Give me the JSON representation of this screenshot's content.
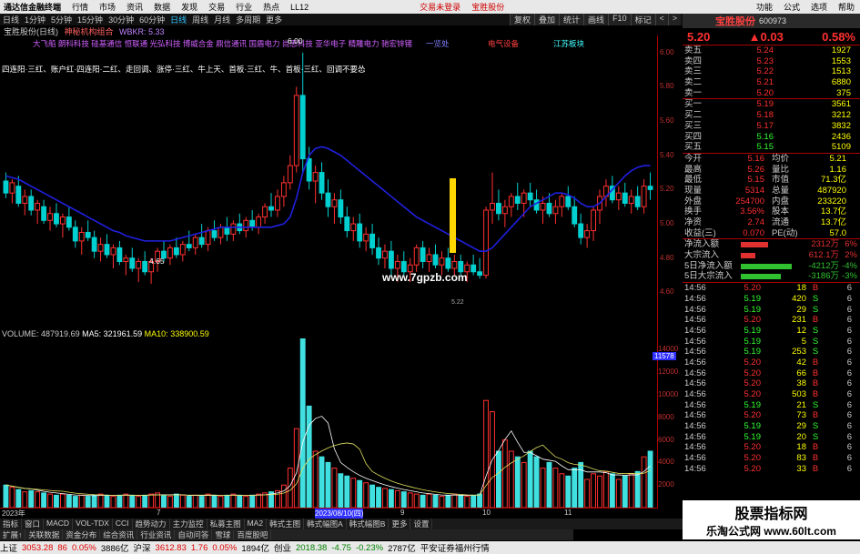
{
  "menubar": {
    "app_title": "通达信金融终端",
    "items": [
      "行情",
      "市场",
      "资讯",
      "数据",
      "发现",
      "交易",
      "行业",
      "热点",
      "LL12"
    ],
    "trade_status": "交易未登录",
    "stock_link": "宝胜股份",
    "right_items": [
      "功能",
      "公式",
      "选项",
      "帮助"
    ]
  },
  "periodbar": {
    "items": [
      "日线",
      "1分钟",
      "5分钟",
      "15分钟",
      "30分钟",
      "60分钟",
      "日线",
      "周线",
      "月线",
      "多周期",
      "更多"
    ],
    "active_index": 6
  },
  "quickbar": [
    "复权",
    "叠加",
    "统计",
    "画线",
    "F10",
    "标记",
    "<",
    ">"
  ],
  "titlebar": {
    "stock": "宝胜股份(日线)",
    "indicator": "神秘机构组合",
    "wbkr": "WBKR: 5.33"
  },
  "chart_labels": {
    "top_names": "大飞船  朗科科技  硅基通信  恒联通  光弘科技  博威合金  鼎信通讯  国盾电力  尚思科技  亚华电子  精雕电力  驰宏锌锗",
    "sector1": "一览处",
    "sector2": "电气设备",
    "sector3": "江苏板块",
    "pattern_text": "四连阳·三红、账户红·四连阳·二红、走回调、涨停·三红、牛上天、首板·三红、牛、首板·三红、回调不要怂",
    "low_label": "4.65",
    "high_label": "6.00",
    "watermark_site": "www.7gpzb.com",
    "bottom_tag": "5.22"
  },
  "chart_data": [
    {
      "type": "candlestick",
      "title": "",
      "ylim": [
        4.4,
        6.1
      ],
      "yticks": [
        "6.00",
        "5.80",
        "5.60",
        "5.40",
        "5.20",
        "5.00",
        "4.80",
        "4.60"
      ],
      "ohlc": [
        [
          5.25,
          5.3,
          5.15,
          5.18
        ],
        [
          5.18,
          5.26,
          5.12,
          5.24
        ],
        [
          5.22,
          5.28,
          5.1,
          5.12
        ],
        [
          5.12,
          5.2,
          5.05,
          5.16
        ],
        [
          5.16,
          5.2,
          5.05,
          5.08
        ],
        [
          5.08,
          5.14,
          5.0,
          5.12
        ],
        [
          5.1,
          5.14,
          5.0,
          5.02
        ],
        [
          5.02,
          5.1,
          4.96,
          5.06
        ],
        [
          5.06,
          5.12,
          4.98,
          5.0
        ],
        [
          5.0,
          5.06,
          4.92,
          5.04
        ],
        [
          5.04,
          5.1,
          4.96,
          4.98
        ],
        [
          4.98,
          5.02,
          4.86,
          4.9
        ],
        [
          4.9,
          4.98,
          4.82,
          4.95
        ],
        [
          4.95,
          5.02,
          4.9,
          4.92
        ],
        [
          4.92,
          4.96,
          4.8,
          4.84
        ],
        [
          4.84,
          4.92,
          4.78,
          4.88
        ],
        [
          4.88,
          4.94,
          4.8,
          4.82
        ],
        [
          4.82,
          4.88,
          4.74,
          4.86
        ],
        [
          4.86,
          4.9,
          4.76,
          4.78
        ],
        [
          4.78,
          4.82,
          4.7,
          4.8
        ],
        [
          4.8,
          4.86,
          4.72,
          4.74
        ],
        [
          4.74,
          4.8,
          4.66,
          4.78
        ],
        [
          4.78,
          4.84,
          4.7,
          4.72
        ],
        [
          4.72,
          4.8,
          4.65,
          4.78
        ],
        [
          4.78,
          4.86,
          4.72,
          4.84
        ],
        [
          4.84,
          4.9,
          4.78,
          4.8
        ],
        [
          4.8,
          4.88,
          4.76,
          4.86
        ],
        [
          4.86,
          4.92,
          4.8,
          4.82
        ],
        [
          4.82,
          4.9,
          4.78,
          4.88
        ],
        [
          4.88,
          4.96,
          4.84,
          4.86
        ],
        [
          4.86,
          4.94,
          4.82,
          4.92
        ],
        [
          4.92,
          5.0,
          4.86,
          4.88
        ],
        [
          4.88,
          4.98,
          4.84,
          4.96
        ],
        [
          4.96,
          5.02,
          4.9,
          4.92
        ],
        [
          4.92,
          5.0,
          4.88,
          4.98
        ],
        [
          4.98,
          5.04,
          4.9,
          4.94
        ],
        [
          4.94,
          5.02,
          4.9,
          5.0
        ],
        [
          5.0,
          5.06,
          4.94,
          4.96
        ],
        [
          4.96,
          5.04,
          4.92,
          5.02
        ],
        [
          5.02,
          5.08,
          4.96,
          4.98
        ],
        [
          4.98,
          5.06,
          4.94,
          5.04
        ],
        [
          5.04,
          5.12,
          5.0,
          5.1
        ],
        [
          5.1,
          5.18,
          5.04,
          5.08
        ],
        [
          5.08,
          5.2,
          5.04,
          5.16
        ],
        [
          5.16,
          5.28,
          5.1,
          5.24
        ],
        [
          5.24,
          5.4,
          5.2,
          5.34
        ],
        [
          5.34,
          5.8,
          5.3,
          5.75
        ],
        [
          5.75,
          6.0,
          5.3,
          5.38
        ],
        [
          5.38,
          5.45,
          5.2,
          5.25
        ],
        [
          5.25,
          5.34,
          5.12,
          5.3
        ],
        [
          5.3,
          5.36,
          5.14,
          5.18
        ],
        [
          5.18,
          5.26,
          5.04,
          5.1
        ],
        [
          5.1,
          5.18,
          5.0,
          5.14
        ],
        [
          5.14,
          5.2,
          5.0,
          5.04
        ],
        [
          5.04,
          5.1,
          4.92,
          4.96
        ],
        [
          4.96,
          5.04,
          4.9,
          5.0
        ],
        [
          5.0,
          5.06,
          4.86,
          4.9
        ],
        [
          4.9,
          4.98,
          4.84,
          4.94
        ],
        [
          4.94,
          5.0,
          4.82,
          4.86
        ],
        [
          4.86,
          4.92,
          4.76,
          4.8
        ],
        [
          4.8,
          4.88,
          4.74,
          4.84
        ],
        [
          4.84,
          4.9,
          4.7,
          4.74
        ],
        [
          4.74,
          4.82,
          4.66,
          4.78
        ],
        [
          4.78,
          4.84,
          4.7,
          4.72
        ],
        [
          4.72,
          4.8,
          4.66,
          4.76
        ],
        [
          4.76,
          4.88,
          4.72,
          4.86
        ],
        [
          4.86,
          4.9,
          4.74,
          4.78
        ],
        [
          4.78,
          4.86,
          4.72,
          4.82
        ],
        [
          4.82,
          4.88,
          4.74,
          4.76
        ],
        [
          4.76,
          4.84,
          4.7,
          4.8
        ],
        [
          4.8,
          4.86,
          4.72,
          4.74
        ],
        [
          4.74,
          4.82,
          4.7,
          4.78
        ],
        [
          4.78,
          4.82,
          4.7,
          4.72
        ],
        [
          4.72,
          4.78,
          4.66,
          4.76
        ],
        [
          4.76,
          4.82,
          4.7,
          4.72
        ],
        [
          4.72,
          4.8,
          4.68,
          4.7
        ],
        [
          4.7,
          5.1,
          4.68,
          5.08
        ],
        [
          5.08,
          5.3,
          5.0,
          5.12
        ],
        [
          5.12,
          5.2,
          5.02,
          5.06
        ],
        [
          5.06,
          5.14,
          4.98,
          5.1
        ],
        [
          5.1,
          5.18,
          5.04,
          5.16
        ],
        [
          5.16,
          5.24,
          5.08,
          5.12
        ],
        [
          5.12,
          5.2,
          5.04,
          5.18
        ],
        [
          5.18,
          5.24,
          5.1,
          5.14
        ],
        [
          5.14,
          5.2,
          5.06,
          5.08
        ],
        [
          5.08,
          5.16,
          5.0,
          5.12
        ],
        [
          5.12,
          5.18,
          5.04,
          5.06
        ],
        [
          5.06,
          5.14,
          5.0,
          5.1
        ],
        [
          5.1,
          5.18,
          5.04,
          5.16
        ],
        [
          5.16,
          5.22,
          5.08,
          5.1
        ],
        [
          5.1,
          5.16,
          4.98,
          5.0
        ],
        [
          5.0,
          5.06,
          4.88,
          4.92
        ],
        [
          4.92,
          5.0,
          4.86,
          4.96
        ],
        [
          4.96,
          5.1,
          4.9,
          5.08
        ],
        [
          5.08,
          5.2,
          5.0,
          5.16
        ],
        [
          5.16,
          5.26,
          5.1,
          5.22
        ],
        [
          5.22,
          5.28,
          5.12,
          5.14
        ],
        [
          5.14,
          5.22,
          5.08,
          5.18
        ],
        [
          5.18,
          5.24,
          5.1,
          5.12
        ],
        [
          5.12,
          5.2,
          5.06,
          5.16
        ],
        [
          5.16,
          5.22,
          5.08,
          5.1
        ],
        [
          5.1,
          5.26,
          5.06,
          5.22
        ],
        [
          5.22,
          5.3,
          5.14,
          5.2
        ]
      ],
      "ma": {
        "name": "",
        "values": [
          5.28,
          5.27,
          5.26,
          5.24,
          5.22,
          5.2,
          5.18,
          5.16,
          5.14,
          5.12,
          5.1,
          5.08,
          5.06,
          5.04,
          5.02,
          5.0,
          4.98,
          4.96,
          4.95,
          4.93,
          4.92,
          4.91,
          4.9,
          4.9,
          4.9,
          4.9,
          4.9,
          4.91,
          4.92,
          4.93,
          4.94,
          4.95,
          4.96,
          4.97,
          4.98,
          4.98,
          4.98,
          4.98,
          4.98,
          4.98,
          4.98,
          4.98,
          4.98,
          4.99,
          5.0,
          5.04,
          5.15,
          5.3,
          5.4,
          5.44,
          5.45,
          5.44,
          5.42,
          5.4,
          5.37,
          5.34,
          5.31,
          5.28,
          5.25,
          5.22,
          5.19,
          5.16,
          5.13,
          5.1,
          5.07,
          5.04,
          5.02,
          5.0,
          4.98,
          4.96,
          4.94,
          4.92,
          4.9,
          4.88,
          4.86,
          4.84,
          4.84,
          4.86,
          4.9,
          4.94,
          4.98,
          5.02,
          5.06,
          5.1,
          5.12,
          5.14,
          5.16,
          5.18,
          5.18,
          5.17,
          5.15,
          5.12,
          5.1,
          5.1,
          5.12,
          5.16,
          5.2,
          5.24,
          5.28,
          5.31,
          5.33,
          5.34,
          5.34
        ]
      }
    },
    {
      "type": "bar",
      "title": "VOLUME",
      "ylim": [
        0,
        15000
      ],
      "yticks": [
        "14000",
        "12000",
        "10000",
        "8000",
        "6000",
        "4000",
        "2000"
      ],
      "values": [
        2000,
        1800,
        1600,
        1400,
        1500,
        1400,
        1300,
        1200,
        1100,
        1200,
        1100,
        1000,
        1100,
        1000,
        1100,
        1200,
        1100,
        1000,
        1100,
        1200,
        1100,
        1000,
        1100,
        1200,
        1300,
        1100,
        1000,
        1200,
        1100,
        1000,
        1100,
        1000,
        1200,
        1100,
        1000,
        1100,
        1200,
        1100,
        1000,
        1100,
        1200,
        1300,
        1400,
        1500,
        2000,
        3500,
        7000,
        15000,
        9000,
        5000,
        4500,
        4000,
        3500,
        3000,
        2800,
        2600,
        2400,
        2200,
        2000,
        1800,
        1700,
        1600,
        1500,
        1400,
        1300,
        1200,
        1100,
        1200,
        1100,
        1000,
        1100,
        1200,
        1100,
        1000,
        1100,
        1200,
        9500,
        8500,
        5000,
        6000,
        5000,
        4500,
        4000,
        5000,
        4500,
        3500,
        4000,
        3500,
        3000,
        2800,
        3500,
        4000,
        2500,
        3000,
        2800,
        3200,
        3000,
        2500,
        2800,
        3000,
        3200,
        4500,
        5000
      ],
      "ma5": "321961.59",
      "ma10": "338900.59",
      "volume": "487919.69",
      "current_tag": "11578",
      "date_labels": [
        "2023年",
        "7",
        "2023/08/10(四)",
        "9",
        "10",
        "11"
      ]
    }
  ],
  "right_panel": {
    "name": "宝胜股份",
    "code": "600973",
    "price": "5.20",
    "change": "0.03",
    "pct": "0.58%",
    "asks": [
      [
        "卖五",
        "5.24",
        "1927"
      ],
      [
        "卖四",
        "5.23",
        "1553"
      ],
      [
        "卖三",
        "5.22",
        "1513"
      ],
      [
        "卖二",
        "5.21",
        "6880"
      ],
      [
        "卖一",
        "5.20",
        "375"
      ]
    ],
    "bids": [
      [
        "买一",
        "5.19",
        "3561"
      ],
      [
        "买二",
        "5.18",
        "3212"
      ],
      [
        "买三",
        "5.17",
        "3832"
      ],
      [
        "买四",
        "5.16",
        "2436"
      ],
      [
        "买五",
        "5.15",
        "5109"
      ]
    ],
    "stats": [
      [
        "今开",
        "5.16",
        "均价",
        "5.21"
      ],
      [
        "最高",
        "5.26",
        "量比",
        "1.16"
      ],
      [
        "最低",
        "5.15",
        "市值",
        "71.3亿"
      ],
      [
        "现量",
        "5314",
        "总量",
        "487920"
      ],
      [
        "外盘",
        "254700",
        "内盘",
        "233220"
      ],
      [
        "换手",
        "3.56%",
        "股本",
        "13.7亿"
      ],
      [
        "净资",
        "2.74",
        "流通",
        "13.7亿"
      ],
      [
        "收益(三)",
        "0.070",
        "PE(动)",
        "57.0"
      ]
    ],
    "flows": [
      [
        "净流入额",
        "2312万",
        "6%",
        "#e03030",
        30
      ],
      [
        "大宗流入",
        "612.1万",
        "2%",
        "#e03030",
        16
      ],
      [
        "5日净流入额",
        "-4212万",
        "-4%",
        "#30c030",
        56
      ],
      [
        "5日大宗流入",
        "-3186万",
        "-3%",
        "#30c030",
        44
      ]
    ],
    "ticks": [
      [
        "14:56",
        "5.20",
        "18",
        "B",
        "6"
      ],
      [
        "14:56",
        "5.19",
        "420",
        "S",
        "6"
      ],
      [
        "14:56",
        "5.19",
        "29",
        "S",
        "6"
      ],
      [
        "14:56",
        "5.20",
        "231",
        "B",
        "6"
      ],
      [
        "14:56",
        "5.19",
        "12",
        "S",
        "6"
      ],
      [
        "14:56",
        "5.19",
        "5",
        "S",
        "6"
      ],
      [
        "14:56",
        "5.19",
        "253",
        "S",
        "6"
      ],
      [
        "14:56",
        "5.20",
        "42",
        "B",
        "6"
      ],
      [
        "14:56",
        "5.20",
        "66",
        "B",
        "6"
      ],
      [
        "14:56",
        "5.20",
        "38",
        "B",
        "6"
      ],
      [
        "14:56",
        "5.20",
        "503",
        "B",
        "6"
      ],
      [
        "14:56",
        "5.19",
        "21",
        "S",
        "6"
      ],
      [
        "14:56",
        "5.20",
        "73",
        "B",
        "6"
      ],
      [
        "14:56",
        "5.19",
        "29",
        "S",
        "6"
      ],
      [
        "14:56",
        "5.19",
        "20",
        "S",
        "6"
      ],
      [
        "14:56",
        "5.20",
        "18",
        "B",
        "6"
      ],
      [
        "14:56",
        "5.20",
        "83",
        "B",
        "6"
      ],
      [
        "14:56",
        "5.20",
        "33",
        "B",
        "6"
      ]
    ]
  },
  "bottomtabs": [
    "指标",
    "窗口",
    "MACD",
    "VOL-TDX",
    "CCI",
    "趋势动力",
    "主力监控",
    "私募主图",
    "MA2",
    "韩式主图",
    "韩式幅图A",
    "韩式幅图B",
    "更多",
    "设置"
  ],
  "bottomtabs2": [
    "扩展↑",
    "关联数据",
    "资金分布",
    "综合资讯",
    "行业资讯",
    "自动问答",
    "雪球",
    "百度股吧"
  ],
  "watermark": {
    "line1": "股票指标网",
    "line2": "乐淘公式网 www.60lt.com"
  },
  "statusbar": {
    "items": [
      [
        "上证",
        "3053.28",
        "86",
        "0.05%",
        "3886亿"
      ],
      [
        "沪深",
        "3612.83",
        "1.76",
        "0.05%",
        "1894亿"
      ],
      [
        "创业",
        "2018.38",
        "-4.75",
        "-0.23%",
        "2787亿"
      ]
    ],
    "broker": "平安证券福州行情"
  }
}
